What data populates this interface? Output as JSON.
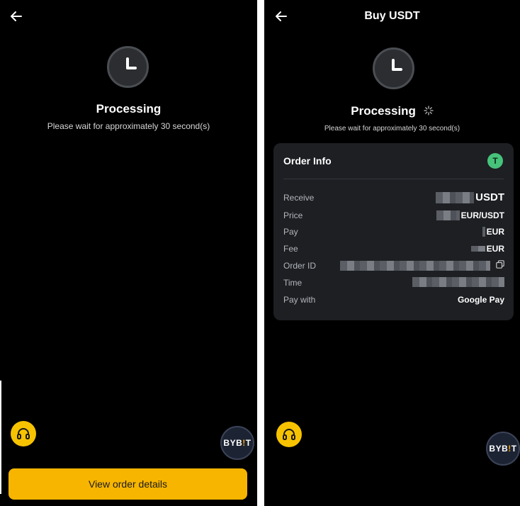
{
  "left": {
    "processing_title": "Processing",
    "processing_sub": "Please wait for approximately 30 second(s)",
    "view_order_label": "View order details",
    "brand_pre": "BYB",
    "brand_accent": "!",
    "brand_post": "T"
  },
  "right": {
    "header_title": "Buy USDT",
    "processing_title": "Processing",
    "processing_sub": "Please wait for approximately 30 second(s)",
    "brand_pre": "BYB",
    "brand_accent": "!",
    "brand_post": "T",
    "order_info": {
      "title": "Order Info",
      "coin_icon": "T",
      "rows": [
        {
          "label": "Receive",
          "value_suffix": "USDT"
        },
        {
          "label": "Price",
          "value_suffix": "EUR/USDT"
        },
        {
          "label": "Pay",
          "value_suffix": "EUR"
        },
        {
          "label": "Fee",
          "value_suffix": "EUR"
        },
        {
          "label": "Order ID",
          "value_suffix": ""
        },
        {
          "label": "Time",
          "value_suffix": ""
        },
        {
          "label": "Pay with",
          "value_suffix": "Google Pay"
        }
      ]
    }
  },
  "colors": {
    "background": "#000000",
    "accent_yellow": "#f7b500",
    "card": "#1d1f23",
    "tether_green": "#47c27a"
  },
  "icons": {
    "back": "back-arrow-icon",
    "clock": "clock-icon",
    "support": "headset-icon",
    "copy": "copy-icon",
    "spinner": "spinner-icon",
    "coin": "tether-icon"
  }
}
